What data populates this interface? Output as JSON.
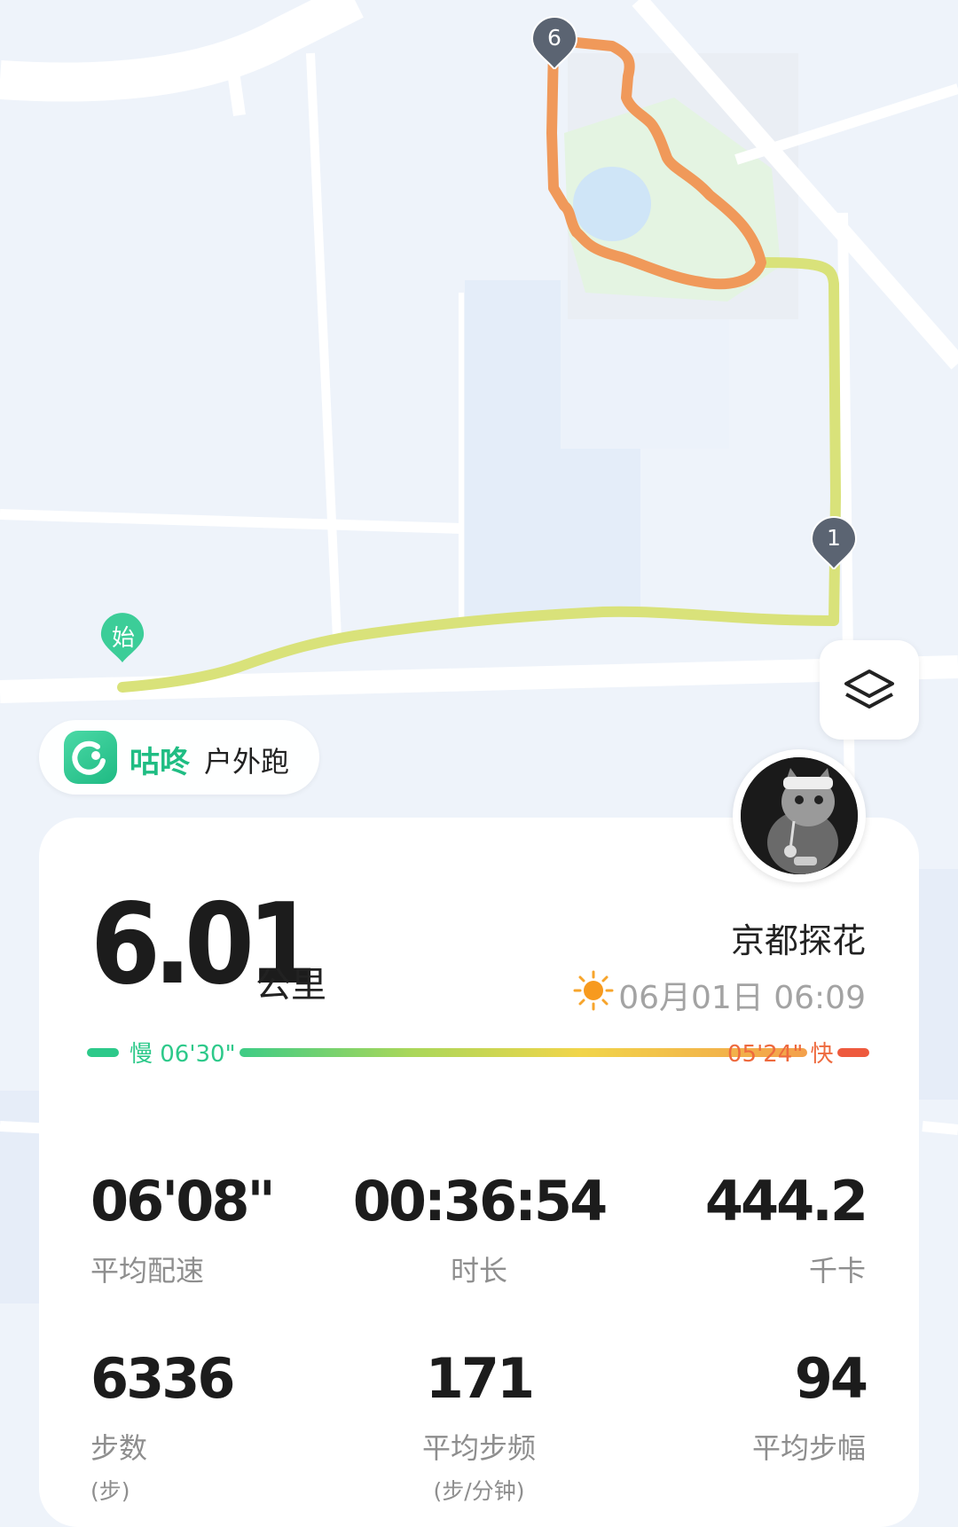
{
  "map": {
    "start_pin": "始",
    "km_markers": [
      "1",
      "6"
    ],
    "layers_icon": "layers-icon"
  },
  "brand": {
    "logo_icon": "gudong-logo-icon",
    "name": "咕咚",
    "activity_type": "户外跑"
  },
  "summary": {
    "distance_value": "6.01",
    "distance_unit": "公里",
    "username": "京都探花",
    "weather_icon": "sun-icon",
    "datetime": "06月01日 06:09"
  },
  "pace_legend": {
    "slow_label": "慢 06'30\"",
    "fast_label": "05'24\" 快",
    "slow_color": "#2dc98a",
    "fast_color": "#ee5a3e"
  },
  "stats": [
    {
      "value": "06'08\"",
      "label": "平均配速",
      "sub": ""
    },
    {
      "value": "00:36:54",
      "label": "时长",
      "sub": ""
    },
    {
      "value": "444.2",
      "label": "千卡",
      "sub": ""
    },
    {
      "value": "6336",
      "label": "步数",
      "sub": "(步)"
    },
    {
      "value": "171",
      "label": "平均步频",
      "sub": "(步/分钟)"
    },
    {
      "value": "94",
      "label": "平均步幅",
      "sub": ""
    }
  ],
  "colors": {
    "brand_green": "#1fbd83",
    "route_slow": "#d9e27a",
    "route_fast": "#f0995a",
    "marker_gray": "#5b6472"
  }
}
